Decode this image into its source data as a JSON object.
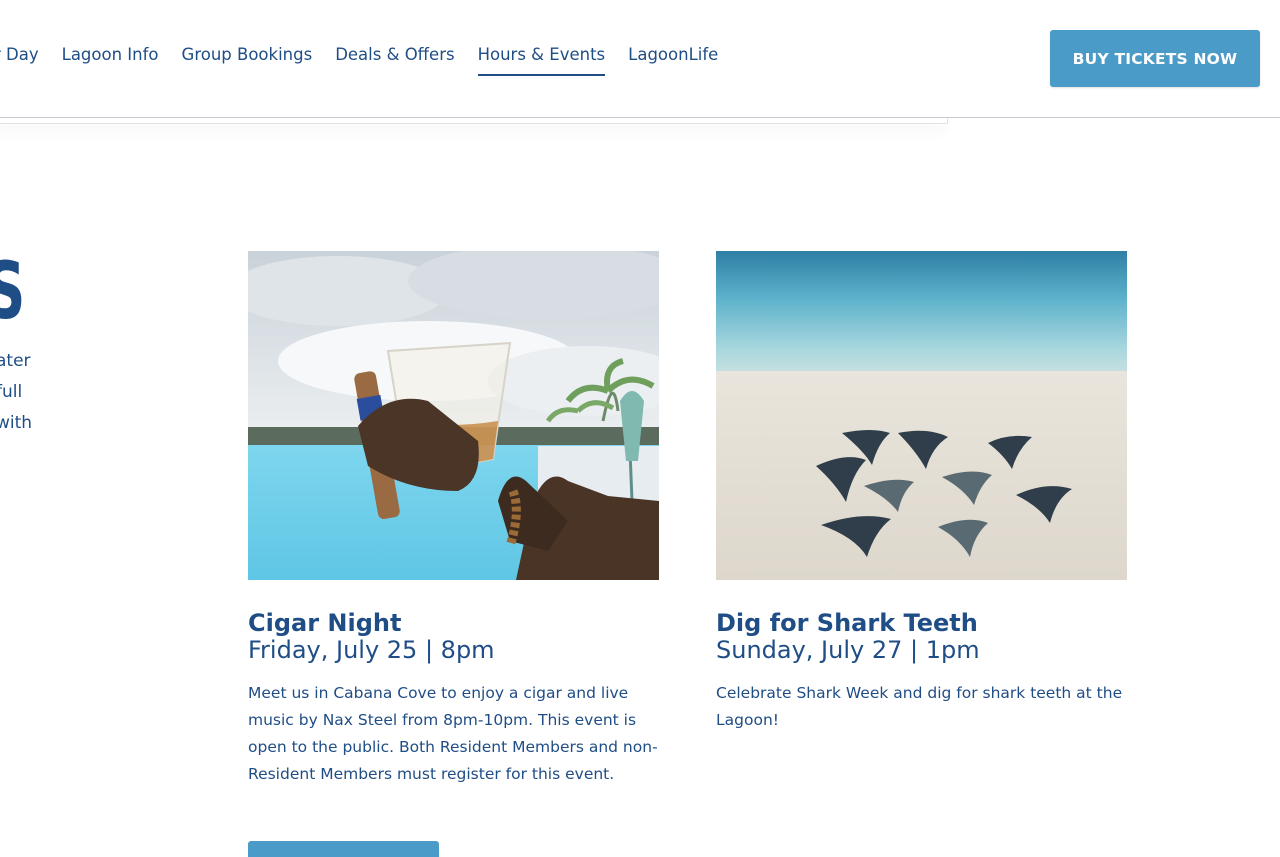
{
  "nav": {
    "items": [
      {
        "label": "r Day",
        "active": false
      },
      {
        "label": "Lagoon Info",
        "active": false
      },
      {
        "label": "Group Bookings",
        "active": false
      },
      {
        "label": "Deals & Offers",
        "active": false
      },
      {
        "label": "Hours & Events",
        "active": true
      },
      {
        "label": "LagoonLife",
        "active": false
      }
    ],
    "buy_label": "BUY TICKETS NOW"
  },
  "left_section": {
    "heading": "S",
    "paragraph_lines": [
      "ater",
      "full",
      " with"
    ]
  },
  "events": [
    {
      "title": "Cigar Night",
      "date": "Friday, July 25 | 8pm",
      "description": "Meet us in Cabana Cove to enjoy a cigar and live music by Nax Steel from 8pm-10pm. This event is open to the public. Both Resident Members and non-Resident Members must register for this event.",
      "image": "cigar-drink-pool-photo"
    },
    {
      "title": "Dig for Shark Teeth",
      "date": "Sunday, July 27 | 1pm",
      "description": "Celebrate Shark Week and dig for shark teeth at the Lagoon!",
      "image": "shark-teeth-beach-photo"
    }
  ],
  "colors": {
    "brand_blue": "#1f4d86",
    "button_blue": "#4b9bc8"
  }
}
